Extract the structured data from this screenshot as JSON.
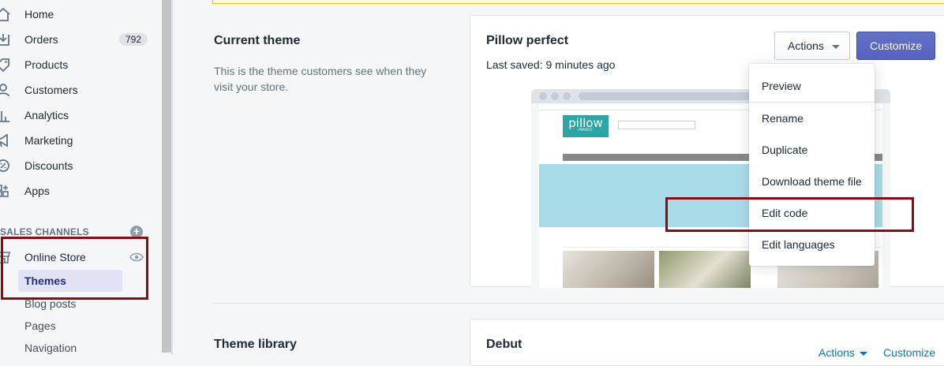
{
  "sidebar": {
    "items": [
      {
        "label": "Home",
        "icon": "home-icon"
      },
      {
        "label": "Orders",
        "icon": "orders-icon",
        "badge": "792"
      },
      {
        "label": "Products",
        "icon": "tag-icon"
      },
      {
        "label": "Customers",
        "icon": "person-icon"
      },
      {
        "label": "Analytics",
        "icon": "chart-icon"
      },
      {
        "label": "Marketing",
        "icon": "megaphone-icon"
      },
      {
        "label": "Discounts",
        "icon": "discount-icon"
      },
      {
        "label": "Apps",
        "icon": "apps-icon"
      }
    ],
    "sales_channels_title": "SALES CHANNELS",
    "online_store": "Online Store",
    "sub_items": [
      "Themes",
      "Blog posts",
      "Pages",
      "Navigation"
    ]
  },
  "main": {
    "current_theme": {
      "title": "Current theme",
      "description": "This is the theme customers see when they visit your store."
    },
    "theme_card": {
      "name": "Pillow perfect",
      "last_saved": "Last saved: 9 minutes ago",
      "actions_label": "Actions",
      "customize_label": "Customize",
      "preview_logo": "pillow",
      "preview_logo_sub": "PERFECT"
    },
    "actions_menu": [
      "Preview",
      "Rename",
      "Duplicate",
      "Download theme file",
      "Edit code",
      "Edit languages"
    ],
    "theme_library": {
      "title": "Theme library",
      "theme_name": "Debut",
      "actions_label": "Actions",
      "customize_label": "Customize"
    }
  },
  "colors": {
    "primary": "#5c6ac4",
    "highlight": "#8b0a14",
    "link": "#007ace"
  }
}
